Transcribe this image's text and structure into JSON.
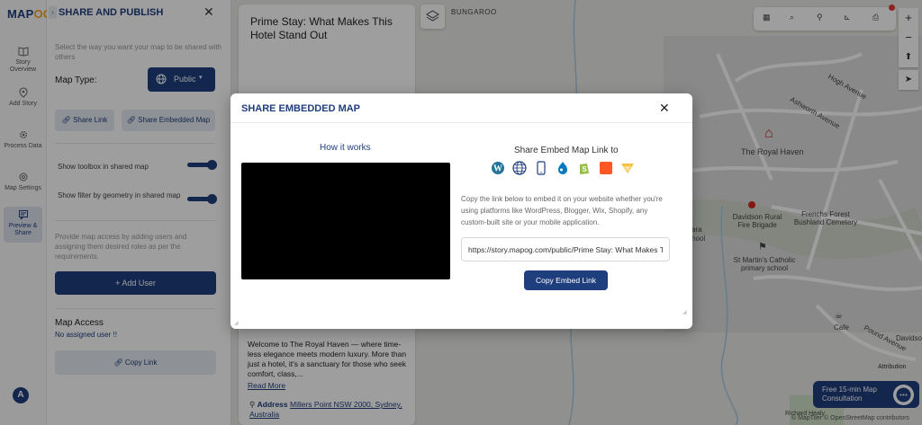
{
  "app": {
    "logo_prefix": "MAP",
    "logo_accent": "OG",
    "brand_color": "#1f3e7d",
    "accent_color": "#f4a51c"
  },
  "rail": {
    "items": [
      {
        "label": "Story Overview",
        "icon": "book-icon"
      },
      {
        "label": "Add Story",
        "icon": "location-pin-icon"
      },
      {
        "label": "Process Data",
        "icon": "gear-icon"
      },
      {
        "label": "Map Settings",
        "icon": "settings-icon"
      },
      {
        "label": "Preview & Share",
        "icon": "share-icon",
        "active": true
      }
    ],
    "avatar": "A"
  },
  "panel": {
    "title": "SHARE AND PUBLISH",
    "intro": "Select the way you want your map to be shared with others",
    "map_type_label": "Map Type:",
    "map_type_value": "Public",
    "share_link": "Share Link",
    "share_embedded": "Share Embedded Map",
    "toggles": [
      {
        "label": "Show toolbox in shared map",
        "on": true
      },
      {
        "label": "Show filter by geometry in shared map",
        "on": true
      }
    ],
    "access_note": "Provide map access by adding users and assigning them desired roles as per the requirements.",
    "add_user": "+ Add User",
    "map_access_title": "Map Access",
    "no_user": "No assigned user !!",
    "copy_link": "Copy Link"
  },
  "story": {
    "title": "Prime Stay: What Makes This Hotel Stand Out",
    "description": "Welcome to The Royal Haven — where time-less elegance meets modern luxury. More than just a hotel, it's a sanctuary for those who seek comfort, class,...",
    "read_more": "Read More",
    "address_label": "Address",
    "address_value": "Millers Point NSW 2000, Sydney, Australia"
  },
  "map": {
    "labels": [
      "BUNGAROO",
      "The Royal Haven",
      "Davidson Rural Fire Brigade",
      "Frenchs Forest Bushland Cemetery",
      "St Martin's Catholic primary school",
      "Cafe",
      "Pound Avenue",
      "Hogh Avenue",
      "Ashworth Avenue",
      "Davidsor",
      "Richard Healy",
      "ara",
      "school"
    ],
    "attribution": "© MapTiler © OpenStreetMap contributors",
    "attribution_button": "Attribution",
    "consult_text": "Free 15-min Map Consultation"
  },
  "modal": {
    "title": "SHARE EMBEDDED MAP",
    "how_it_works": "How it works",
    "embed_title": "Share Embed Map Link to",
    "platforms": [
      "wordpress-icon",
      "globe-icon",
      "mobile-icon",
      "drupal-icon",
      "shopify-icon",
      "blogger-icon",
      "wix-icon"
    ],
    "description": "Copy the link below to embed it on your website whether you're using platforms like WordPress, Blogger, Wix, Shopify, any custom-built site or your mobile application.",
    "link_value": "https://story.mapog.com/public/Prime Stay: What Makes This Hotel Stand Out",
    "copy_button": "Copy Embed Link"
  }
}
